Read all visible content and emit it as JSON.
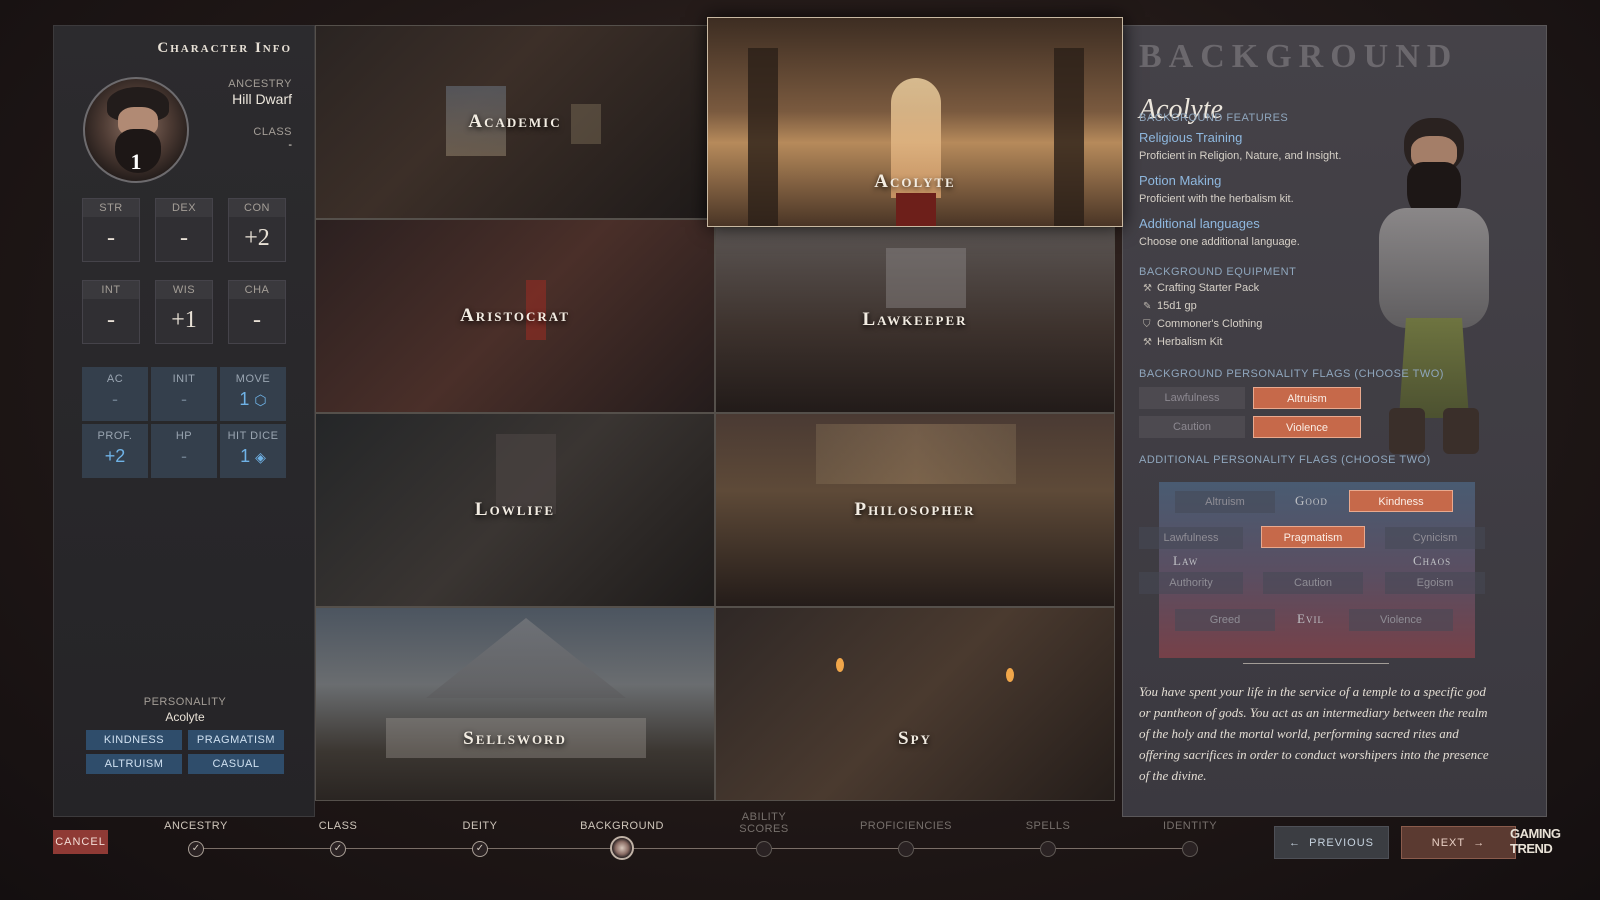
{
  "character_info": {
    "title": "Character Info",
    "level": "1",
    "ancestry_label": "Ancestry",
    "ancestry_value": "Hill Dwarf",
    "class_label": "Class",
    "class_value": "-"
  },
  "abilities": [
    {
      "label": "STR",
      "value": "-"
    },
    {
      "label": "DEX",
      "value": "-"
    },
    {
      "label": "CON",
      "value": "+2"
    },
    {
      "label": "INT",
      "value": "-"
    },
    {
      "label": "WIS",
      "value": "+1"
    },
    {
      "label": "CHA",
      "value": "-"
    }
  ],
  "combat": [
    {
      "label": "AC",
      "value": "-"
    },
    {
      "label": "INIT",
      "value": "-"
    },
    {
      "label": "MOVE",
      "value": "1"
    },
    {
      "label": "PROF.",
      "value": "+2"
    },
    {
      "label": "HP",
      "value": "-"
    },
    {
      "label": "HIT DICE",
      "value": "1"
    }
  ],
  "personality": {
    "title": "PERSONALITY",
    "subtitle": "Acolyte",
    "tags": [
      "KINDNESS",
      "PRAGMATISM",
      "ALTRUISM",
      "CASUAL"
    ]
  },
  "backgrounds": [
    {
      "name": "Academic"
    },
    {
      "name": "Acolyte"
    },
    {
      "name": "Aristocrat"
    },
    {
      "name": "Lawkeeper"
    },
    {
      "name": "Lowlife"
    },
    {
      "name": "Philosopher"
    },
    {
      "name": "Sellsword"
    },
    {
      "name": "Spy"
    }
  ],
  "detail": {
    "title": "BACKGROUND",
    "name": "Acolyte",
    "features_header": "Background Features",
    "features": [
      {
        "title": "Religious Training",
        "desc": "Proficient in Religion, Nature, and Insight."
      },
      {
        "title": "Potion Making",
        "desc": "Proficient with the herbalism kit."
      },
      {
        "title": "Additional languages",
        "desc": "Choose one additional language."
      }
    ],
    "equipment_header": "Background Equipment",
    "equipment": [
      {
        "icon": "crafting-icon",
        "glyph": "⚒",
        "label": "Crafting Starter Pack"
      },
      {
        "icon": "gold-icon",
        "glyph": "✎",
        "label": "15d1 gp"
      },
      {
        "icon": "clothing-icon",
        "glyph": "⛉",
        "label": "Commoner's Clothing"
      },
      {
        "icon": "kit-icon",
        "glyph": "⚒",
        "label": "Herbalism Kit"
      }
    ],
    "bg_flags_header": "Background Personality Flags (Choose Two)",
    "bg_flags": [
      {
        "label": "Lawfulness",
        "selected": false
      },
      {
        "label": "Altruism",
        "selected": true
      },
      {
        "label": "Caution",
        "selected": false
      },
      {
        "label": "Violence",
        "selected": true
      }
    ],
    "add_flags_header": "Additional Personality Flags (Choose Two)",
    "alignment": {
      "good": "Good",
      "evil": "Evil",
      "law": "Law",
      "chaos": "Chaos",
      "altruism": "Altruism",
      "kindness": "Kindness",
      "lawfulness": "Lawfulness",
      "pragmatism": "Pragmatism",
      "cynicism": "Cynicism",
      "authority": "Authority",
      "caution": "Caution",
      "egoism": "Egoism",
      "greed": "Greed",
      "violence": "Violence"
    },
    "description": "You have spent your life in the service of a temple to a specific god or pantheon of gods. You act as an intermediary between the realm of the holy and the mortal world, performing sacred rites and offering sacrifices in order to conduct worshipers into the presence of the divine."
  },
  "footer": {
    "cancel": "CANCEL",
    "steps": [
      {
        "label": "ANCESTRY",
        "state": "done"
      },
      {
        "label": "CLASS",
        "state": "done"
      },
      {
        "label": "DEITY",
        "state": "done"
      },
      {
        "label": "BACKGROUND",
        "state": "active"
      },
      {
        "label": "ABILITY SCORES",
        "state": "todo"
      },
      {
        "label": "PROFICIENCIES",
        "state": "todo"
      },
      {
        "label": "SPELLS",
        "state": "todo"
      },
      {
        "label": "IDENTITY",
        "state": "todo"
      }
    ],
    "previous": "PREVIOUS",
    "next": "NEXT",
    "watermark": "GAMING TREND"
  },
  "colors": {
    "accent_orange": "#c6694a",
    "accent_blue": "#6fb2e6",
    "tag_blue": "#2f4d6b"
  }
}
